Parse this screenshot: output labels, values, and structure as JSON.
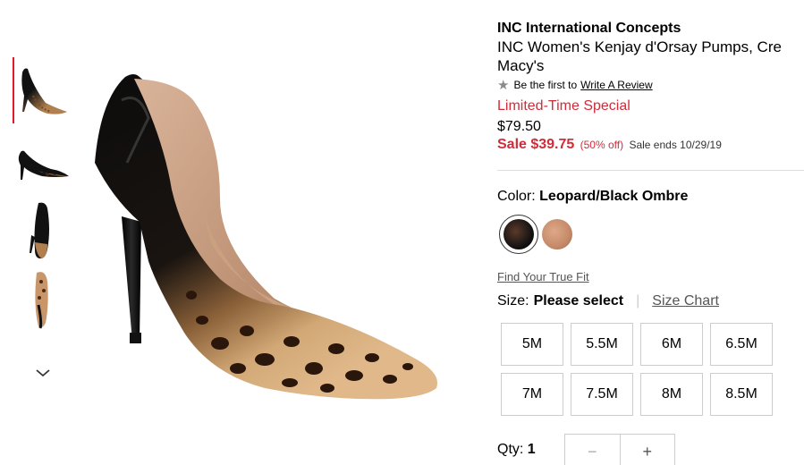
{
  "product": {
    "brand": "INC International Concepts",
    "name": "INC Women's Kenjay d'Orsay Pumps, Created for Macy's",
    "name_line1": "INC Women's Kenjay d'Orsay Pumps, Cre",
    "name_line2": "Macy's",
    "review_prefix": "Be the first to",
    "review_link": "Write A Review",
    "special_label": "Limited-Time Special",
    "original_price": "$79.50",
    "sale_price": "Sale $39.75",
    "sale_percent": "(50% off)",
    "sale_ends": "Sale ends 10/29/19"
  },
  "color": {
    "label": "Color:",
    "selected": "Leopard/Black Ombre",
    "swatches": [
      {
        "name": "Leopard/Black Ombre",
        "color": "#1a1a1a"
      },
      {
        "name": "Nude",
        "color": "#c48a6a"
      }
    ]
  },
  "fit_link": "Find Your True Fit",
  "size": {
    "label": "Size:",
    "selected": "Please select",
    "chart_link": "Size Chart",
    "options": [
      "5M",
      "5.5M",
      "6M",
      "6.5M",
      "7M",
      "7.5M",
      "8M",
      "8.5M"
    ]
  },
  "qty": {
    "label": "Qty:",
    "value": "1",
    "minus": "−",
    "plus": "+"
  },
  "colors": {
    "accent_red": "#d12c3a",
    "border": "#cccccc"
  }
}
